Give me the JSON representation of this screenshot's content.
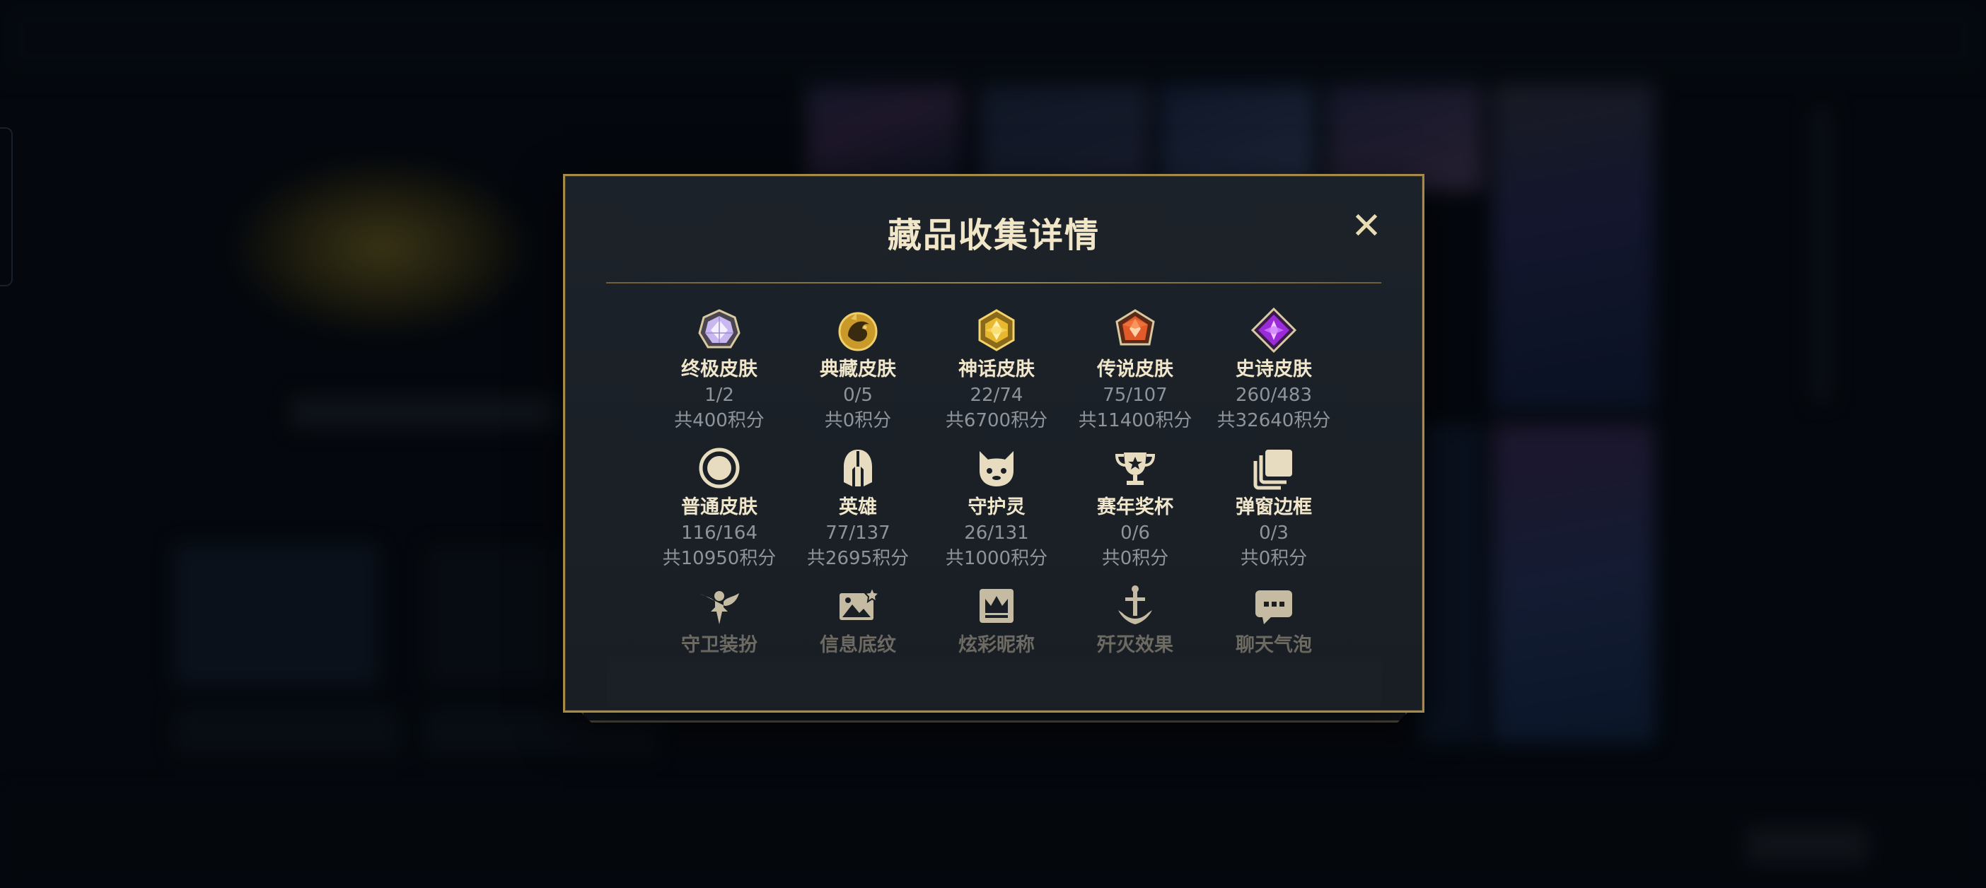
{
  "modal": {
    "title": "藏品收集详情",
    "close_label": "✕"
  },
  "rows": [
    [
      {
        "icon": "ultimate-skin-gem-icon",
        "name": "终极皮肤",
        "count": "1/2",
        "points": "共400积分"
      },
      {
        "icon": "collector-skin-dragon-icon",
        "name": "典藏皮肤",
        "count": "0/5",
        "points": "共0积分"
      },
      {
        "icon": "mythic-skin-gem-icon",
        "name": "神话皮肤",
        "count": "22/74",
        "points": "共6700积分"
      },
      {
        "icon": "legendary-skin-gem-icon",
        "name": "传说皮肤",
        "count": "75/107",
        "points": "共11400积分"
      },
      {
        "icon": "epic-skin-gem-icon",
        "name": "史诗皮肤",
        "count": "260/483",
        "points": "共32640积分"
      }
    ],
    [
      {
        "icon": "normal-skin-ring-icon",
        "name": "普通皮肤",
        "count": "116/164",
        "points": "共10950积分"
      },
      {
        "icon": "hero-helmet-icon",
        "name": "英雄",
        "count": "77/137",
        "points": "共2695积分"
      },
      {
        "icon": "guardian-creature-icon",
        "name": "守护灵",
        "count": "26/131",
        "points": "共1000积分"
      },
      {
        "icon": "season-trophy-icon",
        "name": "赛年奖杯",
        "count": "0/6",
        "points": "共0积分"
      },
      {
        "icon": "popup-frame-icon",
        "name": "弹窗边框",
        "count": "0/3",
        "points": "共0积分"
      }
    ],
    [
      {
        "icon": "guardian-outfit-icon",
        "name": "守卫装扮"
      },
      {
        "icon": "info-pattern-icon",
        "name": "信息底纹"
      },
      {
        "icon": "color-nickname-crown-icon",
        "name": "炫彩昵称"
      },
      {
        "icon": "kill-effect-sword-icon",
        "name": "歼灭效果"
      },
      {
        "icon": "chat-bubble-icon",
        "name": "聊天气泡"
      }
    ]
  ],
  "colors": {
    "gold_border": "#a58a4a",
    "title": "#f1e6c8",
    "muted": "#8e949a"
  }
}
